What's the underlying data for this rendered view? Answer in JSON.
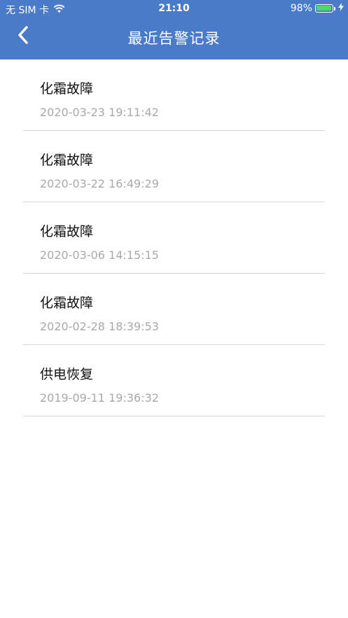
{
  "status_bar": {
    "carrier": "无 SIM 卡",
    "time": "21:10",
    "battery": "98%",
    "battery_level": 0.98,
    "battery_color": "#4cd964"
  },
  "nav": {
    "title": "最近告警记录",
    "back_icon": "chevron-left-icon"
  },
  "alarms": [
    {
      "title": "化霜故障",
      "time": "2020-03-23 19:11:42"
    },
    {
      "title": "化霜故障",
      "time": "2020-03-22 16:49:29"
    },
    {
      "title": "化霜故障",
      "time": "2020-03-06 14:15:15"
    },
    {
      "title": "化霜故障",
      "time": "2020-02-28 18:39:53"
    },
    {
      "title": "供电恢复",
      "time": "2019-09-11 19:36:32"
    }
  ],
  "colors": {
    "header": "#4a7bc8",
    "divider": "#d6d6d6",
    "timestamp": "#a9a9a9"
  }
}
